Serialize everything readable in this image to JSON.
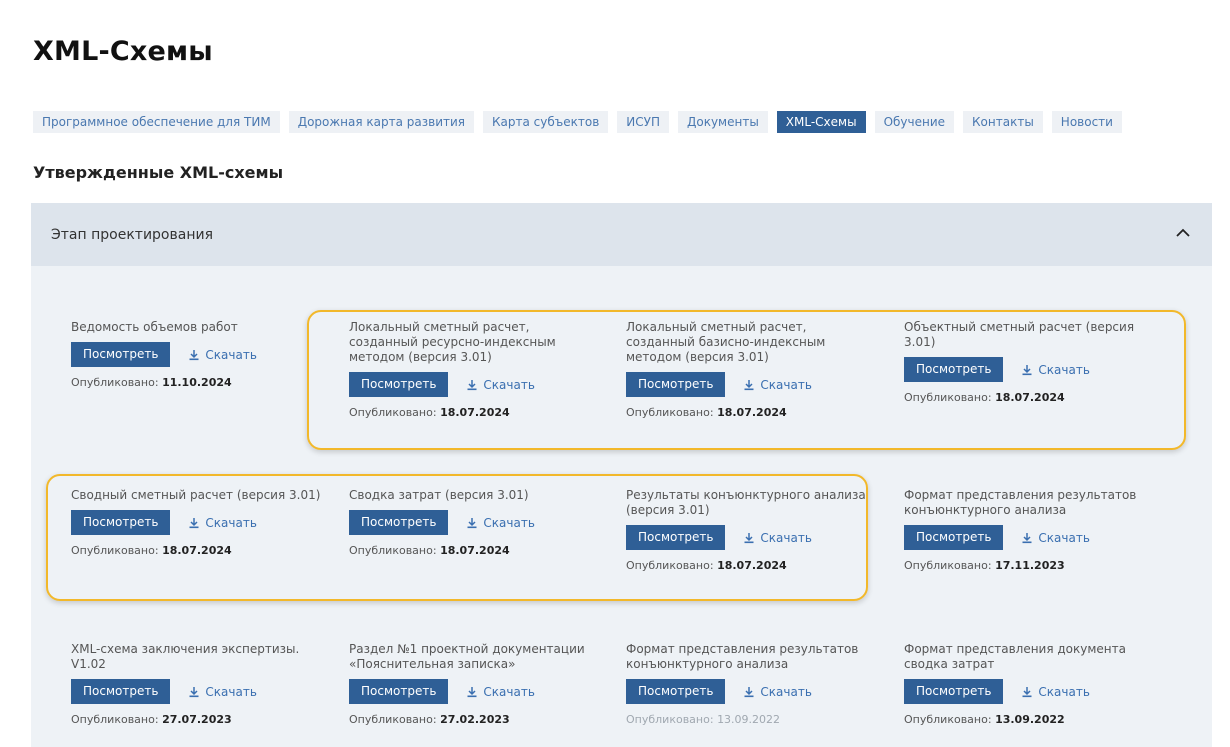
{
  "page": {
    "title": "XML-Схемы"
  },
  "tabs": [
    {
      "label": "Программное обеспечение для ТИМ",
      "active": false
    },
    {
      "label": "Дорожная карта развития",
      "active": false
    },
    {
      "label": "Карта субъектов",
      "active": false
    },
    {
      "label": "ИСУП",
      "active": false
    },
    {
      "label": "Документы",
      "active": false
    },
    {
      "label": "XML-Схемы",
      "active": true
    },
    {
      "label": "Обучение",
      "active": false
    },
    {
      "label": "Контакты",
      "active": false
    },
    {
      "label": "Новости",
      "active": false
    }
  ],
  "section": {
    "title": "Утвержденные XML-схемы"
  },
  "panel": {
    "title": "Этап проектирования",
    "expanded": true,
    "view_label": "Посмотреть",
    "download_label": "Скачать",
    "published_label": "Опубликовано:",
    "items": [
      {
        "title": "Ведомость объемов работ",
        "published": "11.10.2024"
      },
      {
        "title": "Локальный сметный расчет, созданный ресурсно-индексным методом (версия 3.01)",
        "published": "18.07.2024"
      },
      {
        "title": "Локальный сметный расчет, созданный базисно-индексным методом (версия 3.01)",
        "published": "18.07.2024"
      },
      {
        "title": "Объектный сметный расчет (версия 3.01)",
        "published": "18.07.2024"
      },
      {
        "title": "Сводный сметный расчет (версия 3.01)",
        "published": "18.07.2024"
      },
      {
        "title": "Сводка затрат (версия 3.01)",
        "published": "18.07.2024"
      },
      {
        "title": "Результаты конъюнктурного анализа (версия 3.01)",
        "published": "18.07.2024"
      },
      {
        "title": "Формат представления результатов конъюнктурного анализа",
        "published": "17.11.2023"
      },
      {
        "title": "XML-схема заключения экспертизы. V1.02",
        "published": "27.07.2023"
      },
      {
        "title": "Раздел №1 проектной документации «Пояснительная записка»",
        "published": "27.02.2023"
      },
      {
        "title": "Формат представления результатов конъюнктурного анализа",
        "published": "13.09.2022",
        "muted": true
      },
      {
        "title": "Формат представления документа сводка затрат",
        "published": "13.09.2022"
      }
    ]
  },
  "colors": {
    "accent": "#2f5f96",
    "link": "#3a6fb0",
    "highlight": "#f2b82a",
    "panel_bg": "#eef2f6",
    "panel_header_bg": "#dde4ec"
  }
}
